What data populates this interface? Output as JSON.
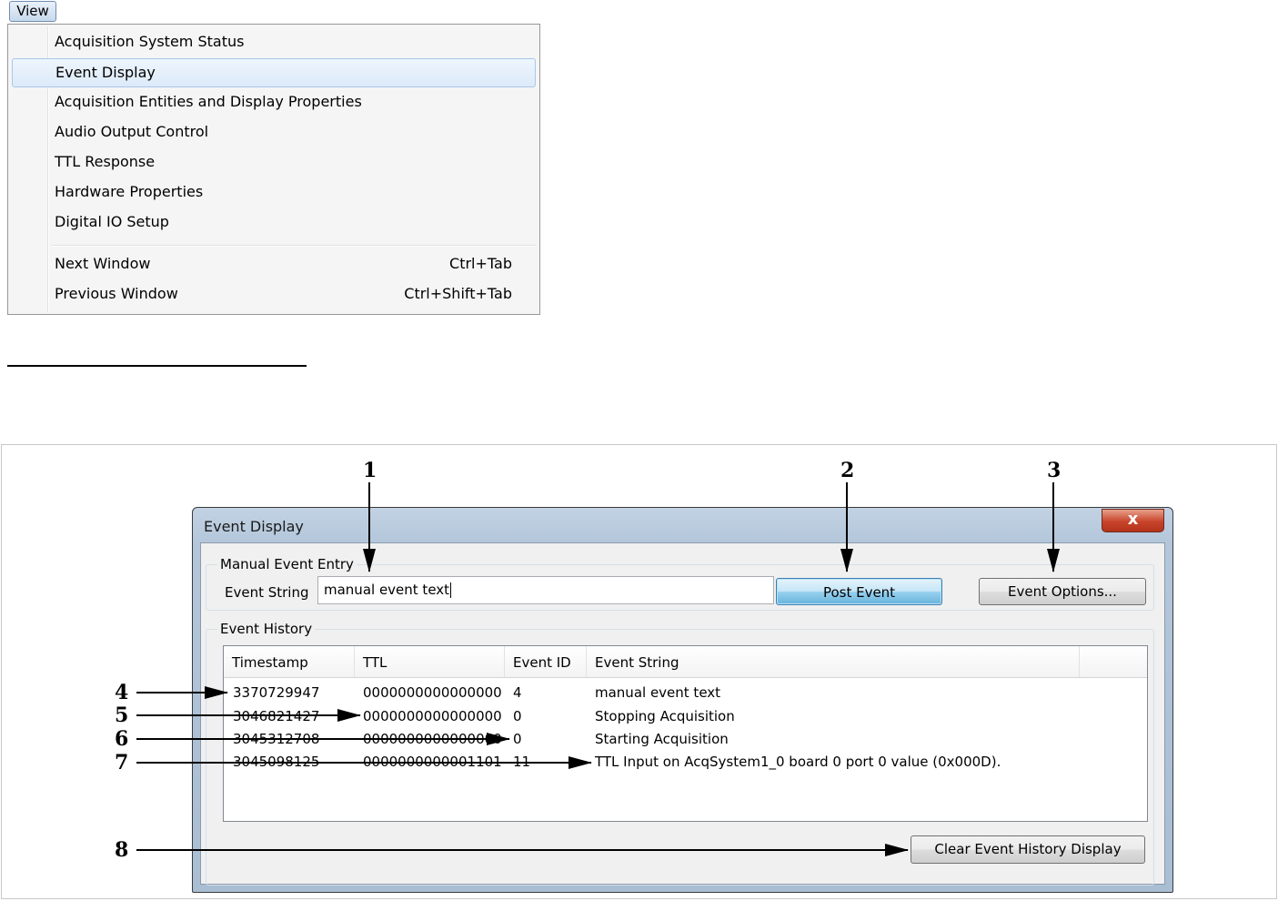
{
  "menu": {
    "title": "View",
    "items": [
      {
        "label": "Acquisition System Status",
        "shortcut": ""
      },
      {
        "label": "Event Display",
        "shortcut": ""
      },
      {
        "label": "Acquisition Entities and Display Properties",
        "shortcut": ""
      },
      {
        "label": "Audio Output Control",
        "shortcut": ""
      },
      {
        "label": "TTL Response",
        "shortcut": ""
      },
      {
        "label": "Hardware Properties",
        "shortcut": ""
      },
      {
        "label": "Digital IO Setup",
        "shortcut": ""
      },
      {
        "label": "Next Window",
        "shortcut": "Ctrl+Tab"
      },
      {
        "label": "Previous Window",
        "shortcut": "Ctrl+Shift+Tab"
      }
    ],
    "highlighted_item": "Event Display"
  },
  "dialog": {
    "title": "Event Display",
    "close_label": "x",
    "manual_entry": {
      "group_title": "Manual Event Entry",
      "field_label": "Event String",
      "field_value": "manual event text",
      "post_button": "Post Event",
      "options_button": "Event Options..."
    },
    "history": {
      "group_title": "Event History",
      "columns": [
        "Timestamp",
        "TTL",
        "Event ID",
        "Event String"
      ],
      "rows": [
        {
          "timestamp": "3370729947",
          "ttl": "0000000000000000",
          "event_id": "4",
          "event_string": "manual event text"
        },
        {
          "timestamp": "3046821427",
          "ttl": "0000000000000000",
          "event_id": "0",
          "event_string": "Stopping Acquisition"
        },
        {
          "timestamp": "3045312708",
          "ttl": "0000000000000000",
          "event_id": "0",
          "event_string": "Starting Acquisition"
        },
        {
          "timestamp": "3045098125",
          "ttl": "0000000000001101",
          "event_id": "11",
          "event_string": "TTL Input on AcqSystem1_0 board 0 port 0 value (0x000D)."
        }
      ],
      "clear_button": "Clear Event History Display"
    }
  },
  "callouts": [
    "1",
    "2",
    "3",
    "4",
    "5",
    "6",
    "7",
    "8"
  ]
}
